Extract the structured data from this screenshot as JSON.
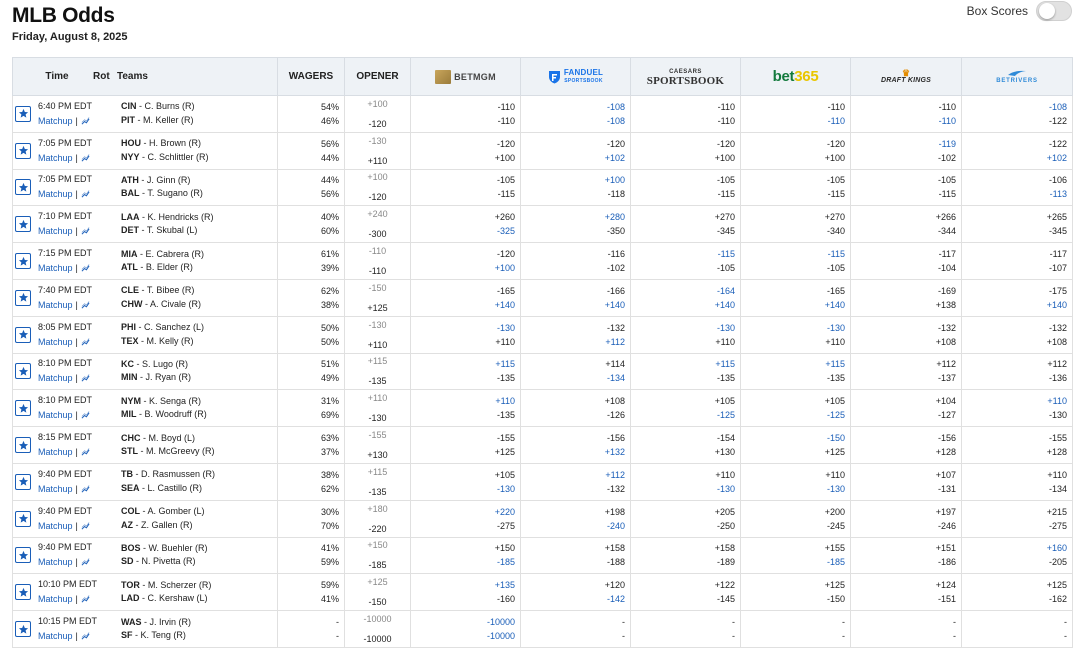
{
  "page": {
    "title": "MLB Odds",
    "date": "Friday, August 8, 2025"
  },
  "box_scores": {
    "label": "Box Scores",
    "enabled": false
  },
  "columns": {
    "time": "Time",
    "rot": "Rot",
    "teams": "Teams",
    "wagers": "WAGERS",
    "opener": "OPENER"
  },
  "books": {
    "betmgm": "BETMGM",
    "fanduel_top": "FANDUEL",
    "fanduel_bottom": "SPORTSBOOK",
    "caesars_top": "CAESARS",
    "caesars_bottom": "SPORTSBOOK",
    "bet365_a": "bet",
    "bet365_b": "365",
    "draftkings": "DRAFT KINGS",
    "betrivers": "BETRIVERS"
  },
  "matchup_label": "Matchup",
  "colors": {
    "link": "#1a5eb8",
    "header_bg": "#eef2f6"
  },
  "games": [
    {
      "time": "6:40 PM EDT",
      "away": {
        "team": "CIN",
        "pitcher": "C. Burns (R)",
        "wagers": "54%",
        "opener": "+100",
        "odds": [
          "-110",
          "-108",
          "-110",
          "-110",
          "-110",
          "-108"
        ]
      },
      "home": {
        "team": "PIT",
        "pitcher": "M. Keller (R)",
        "wagers": "46%",
        "opener": "-120",
        "odds": [
          "-110",
          "-108",
          "-110",
          "-110",
          "-110",
          "-122"
        ]
      },
      "blue_away": [
        1,
        5
      ],
      "blue_home": [
        1,
        3,
        4
      ]
    },
    {
      "time": "7:05 PM EDT",
      "away": {
        "team": "HOU",
        "pitcher": "H. Brown (R)",
        "wagers": "56%",
        "opener": "-130",
        "odds": [
          "-120",
          "-120",
          "-120",
          "-120",
          "-119",
          "-122"
        ]
      },
      "home": {
        "team": "NYY",
        "pitcher": "C. Schlittler (R)",
        "wagers": "44%",
        "opener": "+110",
        "odds": [
          "+100",
          "+102",
          "+100",
          "+100",
          "-102",
          "+102"
        ]
      },
      "blue_away": [
        4
      ],
      "blue_home": [
        1,
        5
      ]
    },
    {
      "time": "7:05 PM EDT",
      "away": {
        "team": "ATH",
        "pitcher": "J. Ginn (R)",
        "wagers": "44%",
        "opener": "+100",
        "odds": [
          "-105",
          "+100",
          "-105",
          "-105",
          "-105",
          "-106"
        ]
      },
      "home": {
        "team": "BAL",
        "pitcher": "T. Sugano (R)",
        "wagers": "56%",
        "opener": "-120",
        "odds": [
          "-115",
          "-118",
          "-115",
          "-115",
          "-115",
          "-113"
        ]
      },
      "blue_away": [
        1
      ],
      "blue_home": [
        5
      ]
    },
    {
      "time": "7:10 PM EDT",
      "away": {
        "team": "LAA",
        "pitcher": "K. Hendricks (R)",
        "wagers": "40%",
        "opener": "+240",
        "odds": [
          "+260",
          "+280",
          "+270",
          "+270",
          "+266",
          "+265"
        ]
      },
      "home": {
        "team": "DET",
        "pitcher": "T. Skubal (L)",
        "wagers": "60%",
        "opener": "-300",
        "odds": [
          "-325",
          "-350",
          "-345",
          "-340",
          "-344",
          "-345"
        ]
      },
      "blue_away": [
        1
      ],
      "blue_home": [
        0
      ]
    },
    {
      "time": "7:15 PM EDT",
      "away": {
        "team": "MIA",
        "pitcher": "E. Cabrera (R)",
        "wagers": "61%",
        "opener": "-110",
        "odds": [
          "-120",
          "-116",
          "-115",
          "-115",
          "-117",
          "-117"
        ]
      },
      "home": {
        "team": "ATL",
        "pitcher": "B. Elder (R)",
        "wagers": "39%",
        "opener": "-110",
        "odds": [
          "+100",
          "-102",
          "-105",
          "-105",
          "-104",
          "-107"
        ]
      },
      "blue_away": [
        2,
        3
      ],
      "blue_home": [
        0
      ]
    },
    {
      "time": "7:40 PM EDT",
      "away": {
        "team": "CLE",
        "pitcher": "T. Bibee (R)",
        "wagers": "62%",
        "opener": "-150",
        "odds": [
          "-165",
          "-166",
          "-164",
          "-165",
          "-169",
          "-175"
        ]
      },
      "home": {
        "team": "CHW",
        "pitcher": "A. Civale (R)",
        "wagers": "38%",
        "opener": "+125",
        "odds": [
          "+140",
          "+140",
          "+140",
          "+140",
          "+138",
          "+140"
        ]
      },
      "blue_away": [
        2
      ],
      "blue_home": [
        0,
        1,
        2,
        3,
        5
      ]
    },
    {
      "time": "8:05 PM EDT",
      "away": {
        "team": "PHI",
        "pitcher": "C. Sanchez (L)",
        "wagers": "50%",
        "opener": "-130",
        "odds": [
          "-130",
          "-132",
          "-130",
          "-130",
          "-132",
          "-132"
        ]
      },
      "home": {
        "team": "TEX",
        "pitcher": "M. Kelly (R)",
        "wagers": "50%",
        "opener": "+110",
        "odds": [
          "+110",
          "+112",
          "+110",
          "+110",
          "+108",
          "+108"
        ]
      },
      "blue_away": [
        0,
        2,
        3
      ],
      "blue_home": [
        1
      ]
    },
    {
      "time": "8:10 PM EDT",
      "away": {
        "team": "KC",
        "pitcher": "S. Lugo (R)",
        "wagers": "51%",
        "opener": "+115",
        "odds": [
          "+115",
          "+114",
          "+115",
          "+115",
          "+112",
          "+112"
        ]
      },
      "home": {
        "team": "MIN",
        "pitcher": "J. Ryan (R)",
        "wagers": "49%",
        "opener": "-135",
        "odds": [
          "-135",
          "-134",
          "-135",
          "-135",
          "-137",
          "-136"
        ]
      },
      "blue_away": [
        0,
        2,
        3
      ],
      "blue_home": [
        1
      ]
    },
    {
      "time": "8:10 PM EDT",
      "away": {
        "team": "NYM",
        "pitcher": "K. Senga (R)",
        "wagers": "31%",
        "opener": "+110",
        "odds": [
          "+110",
          "+108",
          "+105",
          "+105",
          "+104",
          "+110"
        ]
      },
      "home": {
        "team": "MIL",
        "pitcher": "B. Woodruff (R)",
        "wagers": "69%",
        "opener": "-130",
        "odds": [
          "-135",
          "-126",
          "-125",
          "-125",
          "-127",
          "-130"
        ]
      },
      "blue_away": [
        0,
        5
      ],
      "blue_home": [
        2,
        3
      ]
    },
    {
      "time": "8:15 PM EDT",
      "away": {
        "team": "CHC",
        "pitcher": "M. Boyd (L)",
        "wagers": "63%",
        "opener": "-155",
        "odds": [
          "-155",
          "-156",
          "-154",
          "-150",
          "-156",
          "-155"
        ]
      },
      "home": {
        "team": "STL",
        "pitcher": "M. McGreevy (R)",
        "wagers": "37%",
        "opener": "+130",
        "odds": [
          "+125",
          "+132",
          "+130",
          "+125",
          "+128",
          "+128"
        ]
      },
      "blue_away": [
        3
      ],
      "blue_home": [
        1
      ]
    },
    {
      "time": "9:40 PM EDT",
      "away": {
        "team": "TB",
        "pitcher": "D. Rasmussen (R)",
        "wagers": "38%",
        "opener": "+115",
        "odds": [
          "+105",
          "+112",
          "+110",
          "+110",
          "+107",
          "+110"
        ]
      },
      "home": {
        "team": "SEA",
        "pitcher": "L. Castillo (R)",
        "wagers": "62%",
        "opener": "-135",
        "odds": [
          "-130",
          "-132",
          "-130",
          "-130",
          "-131",
          "-134"
        ]
      },
      "blue_away": [
        1
      ],
      "blue_home": [
        0,
        2,
        3
      ]
    },
    {
      "time": "9:40 PM EDT",
      "away": {
        "team": "COL",
        "pitcher": "A. Gomber (L)",
        "wagers": "30%",
        "opener": "+180",
        "odds": [
          "+220",
          "+198",
          "+205",
          "+200",
          "+197",
          "+215"
        ]
      },
      "home": {
        "team": "AZ",
        "pitcher": "Z. Gallen (R)",
        "wagers": "70%",
        "opener": "-220",
        "odds": [
          "-275",
          "-240",
          "-250",
          "-245",
          "-246",
          "-275"
        ]
      },
      "blue_away": [
        0
      ],
      "blue_home": [
        1
      ]
    },
    {
      "time": "9:40 PM EDT",
      "away": {
        "team": "BOS",
        "pitcher": "W. Buehler (R)",
        "wagers": "41%",
        "opener": "+150",
        "odds": [
          "+150",
          "+158",
          "+158",
          "+155",
          "+151",
          "+160"
        ]
      },
      "home": {
        "team": "SD",
        "pitcher": "N. Pivetta (R)",
        "wagers": "59%",
        "opener": "-185",
        "odds": [
          "-185",
          "-188",
          "-189",
          "-185",
          "-186",
          "-205"
        ]
      },
      "blue_away": [
        5
      ],
      "blue_home": [
        0,
        3
      ]
    },
    {
      "time": "10:10 PM EDT",
      "away": {
        "team": "TOR",
        "pitcher": "M. Scherzer (R)",
        "wagers": "59%",
        "opener": "+125",
        "odds": [
          "+135",
          "+120",
          "+122",
          "+125",
          "+124",
          "+125"
        ]
      },
      "home": {
        "team": "LAD",
        "pitcher": "C. Kershaw (L)",
        "wagers": "41%",
        "opener": "-150",
        "odds": [
          "-160",
          "-142",
          "-145",
          "-150",
          "-151",
          "-162"
        ]
      },
      "blue_away": [
        0
      ],
      "blue_home": [
        1
      ]
    },
    {
      "time": "10:15 PM EDT",
      "away": {
        "team": "WAS",
        "pitcher": "J. Irvin (R)",
        "wagers": "-",
        "opener": "-10000",
        "odds": [
          "-10000",
          "-",
          "-",
          "-",
          "-",
          "-"
        ]
      },
      "home": {
        "team": "SF",
        "pitcher": "K. Teng (R)",
        "wagers": "-",
        "opener": "-10000",
        "odds": [
          "-10000",
          "-",
          "-",
          "-",
          "-",
          "-"
        ]
      },
      "blue_away": [
        0
      ],
      "blue_home": [
        0
      ]
    }
  ]
}
